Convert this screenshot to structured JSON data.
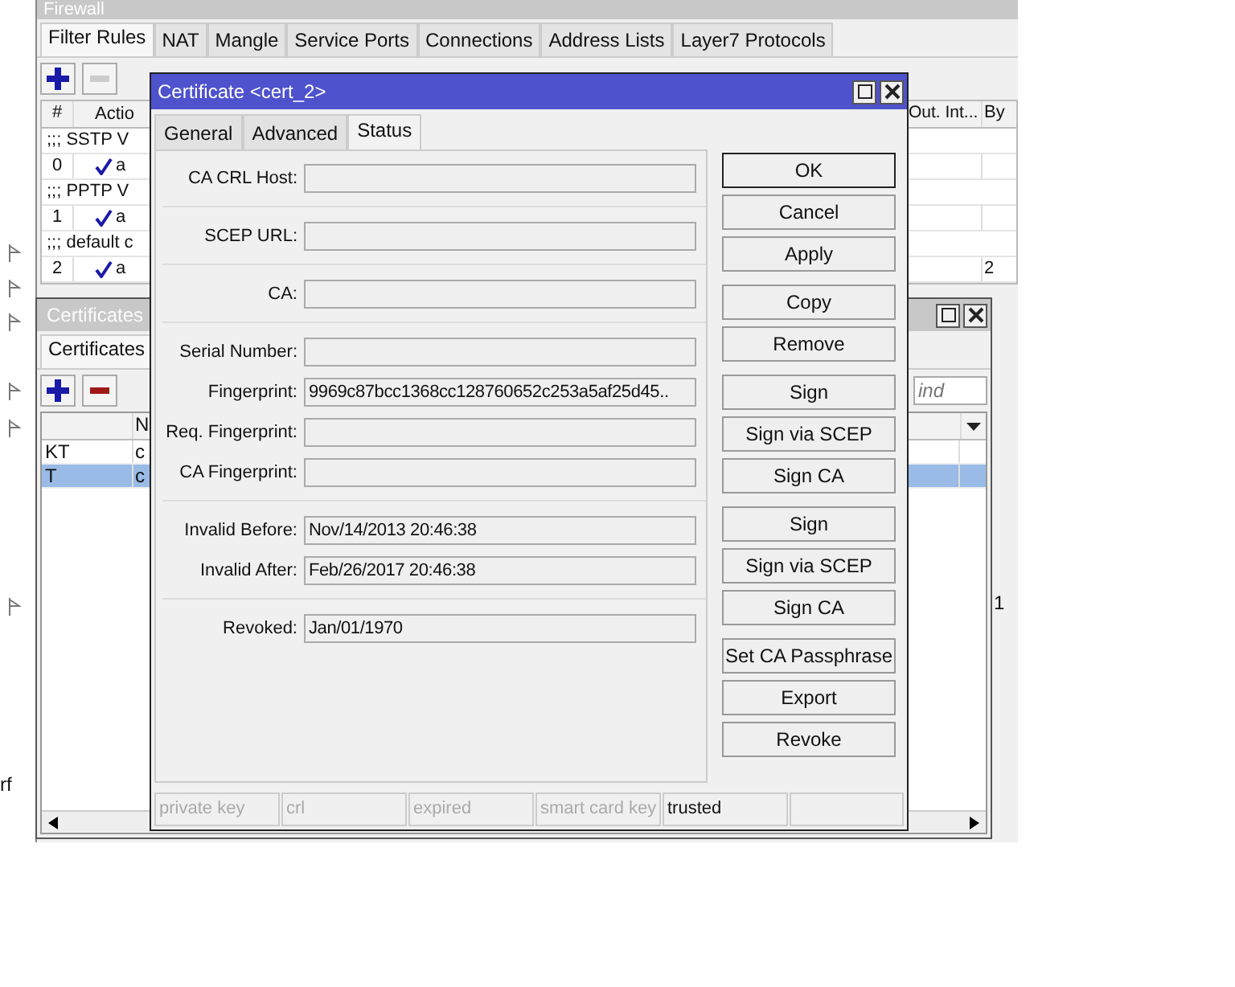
{
  "firewall": {
    "title": "Firewall",
    "tabs": [
      {
        "label": "Filter Rules",
        "selected": true
      },
      {
        "label": "NAT",
        "selected": false
      },
      {
        "label": "Mangle",
        "selected": false
      },
      {
        "label": "Service Ports",
        "selected": false
      },
      {
        "label": "Connections",
        "selected": false
      },
      {
        "label": "Address Lists",
        "selected": false
      },
      {
        "label": "Layer7 Protocols",
        "selected": false
      }
    ],
    "columns": [
      "#",
      "Actio",
      "Out. Int...",
      "By"
    ],
    "rows": [
      {
        "kind": "comment",
        "text": ";;; SSTP V"
      },
      {
        "kind": "rule",
        "number": "0",
        "action": "a"
      },
      {
        "kind": "comment",
        "text": ";;; PPTP V"
      },
      {
        "kind": "rule",
        "number": "1",
        "action": "a"
      },
      {
        "kind": "comment",
        "text": ";;; default c"
      },
      {
        "kind": "rule",
        "number": "2",
        "action": "a",
        "by": "2"
      }
    ],
    "edge_value": "1"
  },
  "left_window": {
    "fragment": "rf"
  },
  "certificates": {
    "title": "Certificates",
    "tabs": [
      {
        "label": "Certificates",
        "selected": true
      }
    ],
    "find": {
      "placeholder": "ind"
    },
    "column": "N",
    "rows": [
      {
        "name": "KT",
        "common": "c",
        "selected": false
      },
      {
        "name": "T",
        "common": "c",
        "selected": true
      }
    ]
  },
  "dialog": {
    "title": "Certificate <cert_2>",
    "tabs": [
      {
        "label": "General",
        "selected": false
      },
      {
        "label": "Advanced",
        "selected": false
      },
      {
        "label": "Status",
        "selected": true
      }
    ],
    "field_groups": [
      [
        {
          "label": "CA CRL Host:"
        }
      ],
      [
        {
          "label": "SCEP URL:"
        }
      ],
      [
        {
          "label": "CA:"
        }
      ],
      [
        {
          "label": "Serial Number:"
        },
        {
          "label": "Fingerprint:",
          "value": "9969c87bcc1368cc128760652c253a5af25d45.."
        },
        {
          "label": "Req. Fingerprint:"
        },
        {
          "label": "CA Fingerprint:"
        }
      ],
      [
        {
          "label": "Invalid Before:",
          "value": "Nov/14/2013 20:46:38"
        },
        {
          "label": "Invalid After:",
          "value": "Feb/26/2017 20:46:38"
        }
      ],
      [
        {
          "label": "Revoked:",
          "value": "Jan/01/1970"
        }
      ]
    ],
    "button_groups": [
      [
        {
          "label": "OK",
          "default": true
        },
        {
          "label": "Cancel",
          "default": false
        },
        {
          "label": "Apply",
          "default": false
        }
      ],
      [
        {
          "label": "Copy",
          "default": false
        },
        {
          "label": "Remove",
          "default": false
        }
      ],
      [
        {
          "label": "Sign",
          "default": false
        },
        {
          "label": "Sign via SCEP",
          "default": false
        },
        {
          "label": "Sign CA",
          "default": false
        }
      ],
      [
        {
          "label": "Sign",
          "default": false
        },
        {
          "label": "Sign via SCEP",
          "default": false
        },
        {
          "label": "Sign CA",
          "default": false
        }
      ],
      [
        {
          "label": "Set CA Passphrase",
          "default": false
        },
        {
          "label": "Export",
          "default": false
        },
        {
          "label": "Revoke",
          "default": false
        }
      ]
    ],
    "flags": [
      {
        "label": "private key",
        "on": false
      },
      {
        "label": "crl",
        "on": false
      },
      {
        "label": "expired",
        "on": false
      },
      {
        "label": "smart card key",
        "on": false
      },
      {
        "label": "trusted",
        "on": true
      }
    ]
  }
}
